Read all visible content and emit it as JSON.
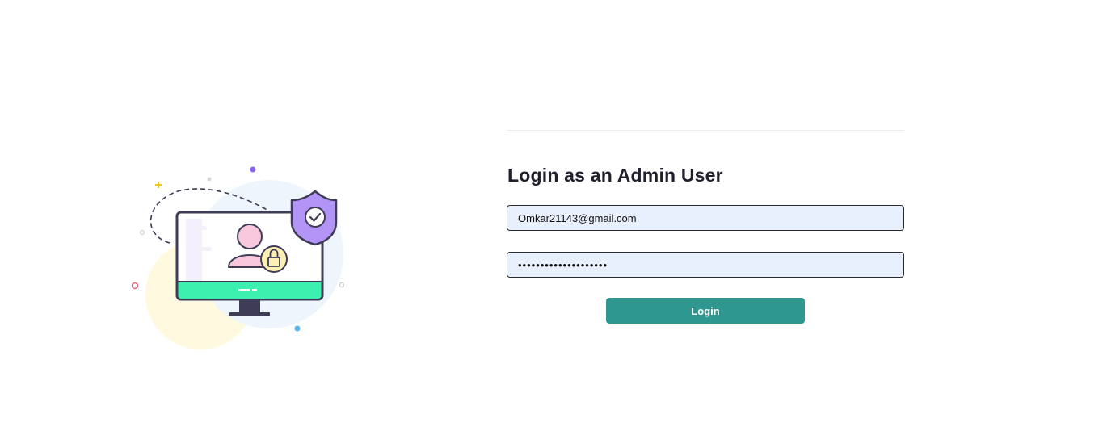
{
  "login_form": {
    "title": "Login as an Admin User",
    "email_value": "Omkar21143@gmail.com",
    "password_value": "••••••••••••••••••••",
    "login_label": "Login"
  },
  "illustration": {
    "icons": [
      "monitor-icon",
      "user-icon",
      "padlock-icon",
      "shield-check-icon"
    ],
    "colors": {
      "outline": "#3f3d56",
      "screen_bar": "#3ef0b0",
      "shield": "#b294f7",
      "user": "#f9c8dc",
      "lock": "#fdf0b5",
      "blob_blue": "#eef5fd",
      "blob_yellow": "#fff9e0"
    }
  },
  "theme": {
    "accent": "#2e9890",
    "field_bg": "#e8f0fe"
  }
}
